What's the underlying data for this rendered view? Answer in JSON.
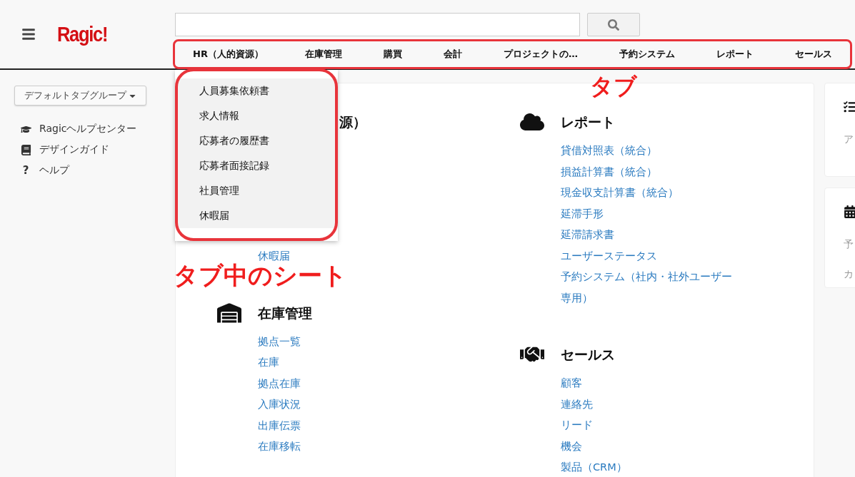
{
  "header": {
    "logo": "Ragic!"
  },
  "tabs": [
    {
      "label": "HR（人的資源）"
    },
    {
      "label": "在庫管理"
    },
    {
      "label": "購買"
    },
    {
      "label": "会計"
    },
    {
      "label": "プロジェクトの…"
    },
    {
      "label": "予約システム"
    },
    {
      "label": "レポート"
    },
    {
      "label": "セールス"
    }
  ],
  "tab_menu": {
    "items": [
      "人員募集依頼書",
      "求人情報",
      "応募者の履歴書",
      "応募者面接記録",
      "社員管理",
      "休暇届"
    ]
  },
  "sidebar": {
    "group_selector": "デフォルトタブグループ",
    "links": [
      {
        "kind": "cap",
        "label": "Ragicヘルプセンター"
      },
      {
        "kind": "book",
        "label": "デザインガイド"
      },
      {
        "kind": "char",
        "icon": "?",
        "label": "ヘルプ"
      }
    ]
  },
  "columns": [
    [
      {
        "kind": "covered",
        "heading": "源）",
        "links": [
          "休暇届"
        ]
      },
      {
        "kind": "warehouse",
        "heading": "在庫管理",
        "links": [
          "拠点一覧",
          "在庫",
          "拠点在庫",
          "入庫状況",
          "出庫伝票",
          "在庫移転"
        ]
      }
    ],
    [
      {
        "kind": "cloud",
        "heading": "レポート",
        "links": [
          "貸借対照表（統合）",
          "損益計算書（統合）",
          "現金収支計算書（統合）",
          "延滞手形",
          "延滞請求書",
          "ユーザーステータス",
          "予約システム（社内・社外ユーザー専用）"
        ]
      },
      {
        "kind": "handshake",
        "heading": "セールス",
        "links": [
          "顧客",
          "連絡先",
          "リード",
          "機会",
          "製品（CRM）"
        ]
      }
    ]
  ],
  "side_cards": [
    {
      "kind": "checklist",
      "lines": [
        "ア"
      ]
    },
    {
      "kind": "calendar",
      "lines": [
        "予",
        "カ"
      ]
    }
  ],
  "annotations": [
    {
      "kind": "tabs",
      "text": "タブ"
    },
    {
      "kind": "tab_menu",
      "text": "タブ中のシート"
    }
  ]
}
